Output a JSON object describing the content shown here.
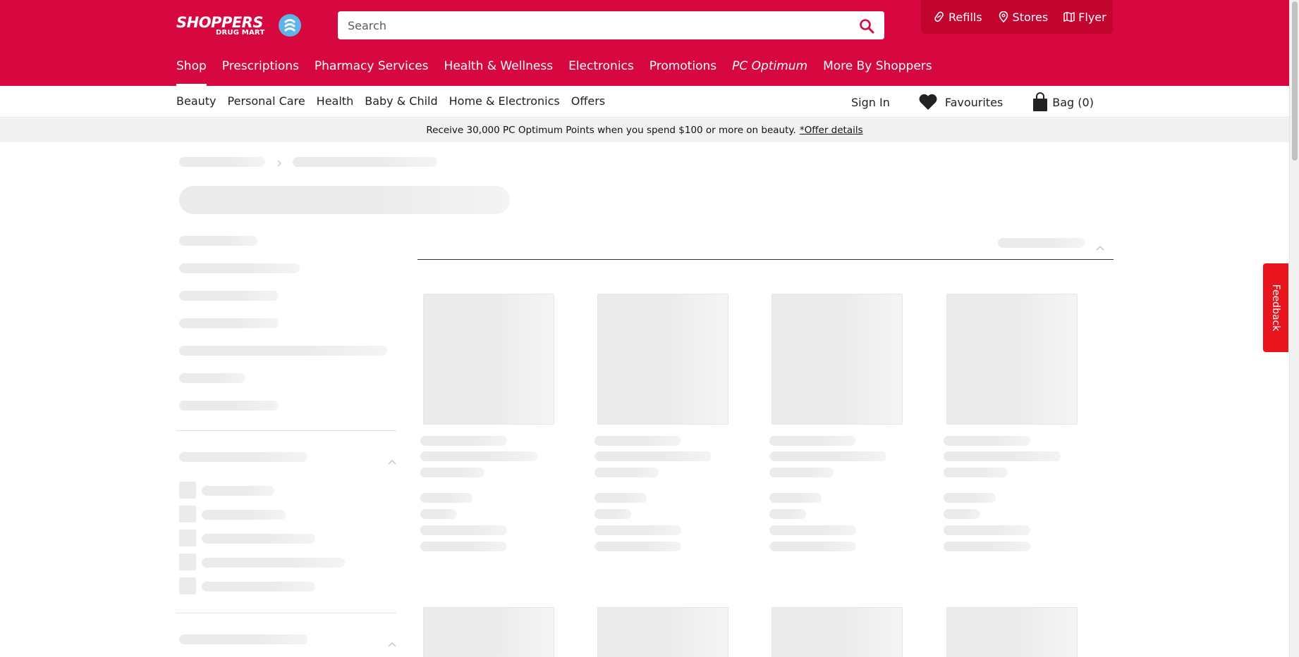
{
  "header": {
    "logo": {
      "line1": "SHOPPERS",
      "line2": "DRUG MART"
    },
    "search": {
      "placeholder": "Search"
    },
    "utility": {
      "refills": "Refills",
      "stores": "Stores",
      "flyer": "Flyer"
    },
    "nav": [
      "Shop",
      "Prescriptions",
      "Pharmacy Services",
      "Health & Wellness",
      "Electronics",
      "Promotions",
      "PC Optimum",
      "More By Shoppers"
    ],
    "active_nav": "Shop",
    "colors": {
      "brand": "#d7083f",
      "utility_bg": "#c2052f"
    }
  },
  "subnav": {
    "categories": [
      "Beauty",
      "Personal Care",
      "Health",
      "Baby & Child",
      "Home & Electronics",
      "Offers"
    ],
    "sign_in": "Sign In",
    "favourites": "Favourites",
    "bag": "Bag (0)"
  },
  "promo": {
    "text": "Receive 30,000 PC Optimum Points when you spend $100 or more on beauty.",
    "link": "*Offer details"
  },
  "feedback": {
    "label": "Feedback",
    "color": "#e8151f"
  },
  "loading_state": {
    "status": "loading"
  }
}
